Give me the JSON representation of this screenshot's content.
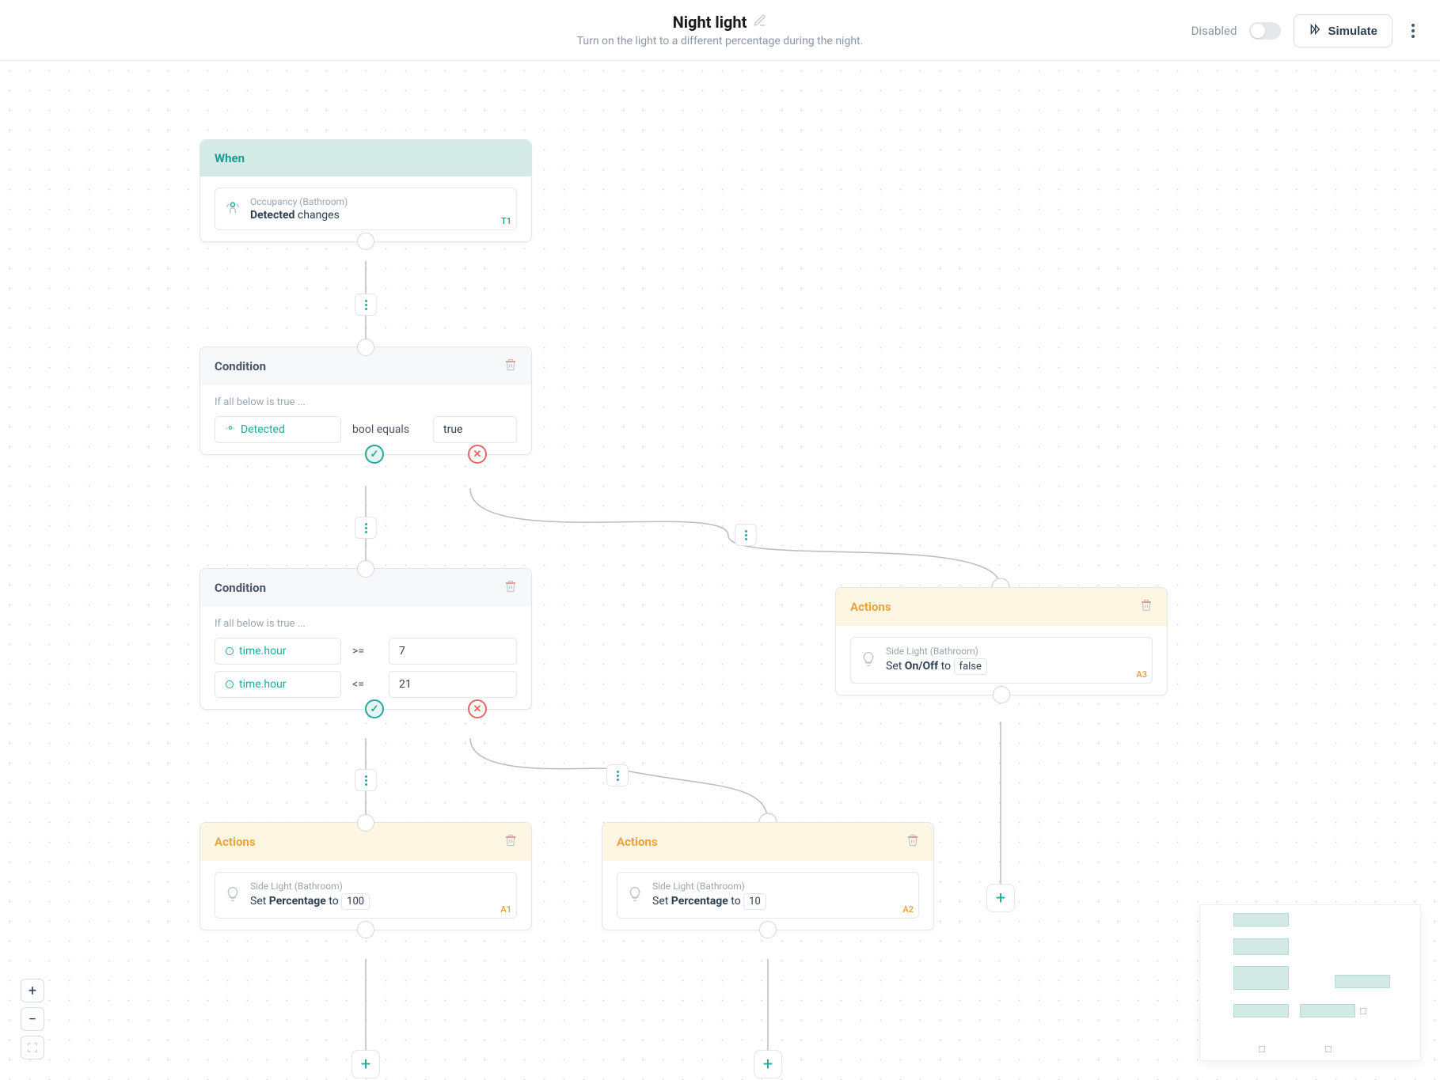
{
  "header": {
    "title": "Night light",
    "subtitle": "Turn on the light to a different percentage during the night.",
    "disabled_label": "Disabled",
    "simulate_label": "Simulate"
  },
  "nodes": {
    "when": {
      "title": "When",
      "trigger": {
        "device": "Occupancy (Bathroom)",
        "property_bold": "Detected",
        "verb": "changes",
        "badge": "T1"
      }
    },
    "cond1": {
      "title": "Condition",
      "hint": "If all below is true ...",
      "row": {
        "chip": "Detected",
        "op": "bool equals",
        "value": "true"
      }
    },
    "cond2": {
      "title": "Condition",
      "hint": "If all below is true ...",
      "rows": [
        {
          "chip": "time.hour",
          "op": ">=",
          "value": "7"
        },
        {
          "chip": "time.hour",
          "op": "<=",
          "value": "21"
        }
      ]
    },
    "act1": {
      "title": "Actions",
      "card": {
        "device": "Side Light (Bathroom)",
        "set_prefix": "Set ",
        "set_bold": "Percentage",
        "set_suffix": " to ",
        "value": "100",
        "badge": "A1"
      }
    },
    "act2": {
      "title": "Actions",
      "card": {
        "device": "Side Light (Bathroom)",
        "set_prefix": "Set ",
        "set_bold": "Percentage",
        "set_suffix": " to ",
        "value": "10",
        "badge": "A2"
      }
    },
    "act3": {
      "title": "Actions",
      "card": {
        "device": "Side Light (Bathroom)",
        "set_prefix": "Set ",
        "set_bold": "On/Off",
        "set_suffix": " to ",
        "value": "false",
        "badge": "A3"
      }
    }
  }
}
